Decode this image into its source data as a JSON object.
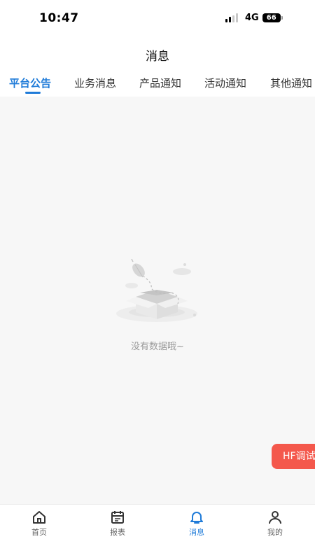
{
  "status_bar": {
    "time": "10:47",
    "network": "4G",
    "battery": "66"
  },
  "header": {
    "title": "消息"
  },
  "tabs": [
    {
      "label": "平台公告",
      "active": true
    },
    {
      "label": "业务消息",
      "active": false
    },
    {
      "label": "产品通知",
      "active": false
    },
    {
      "label": "活动通知",
      "active": false
    },
    {
      "label": "其他通知",
      "active": false
    }
  ],
  "empty_state": {
    "text": "没有数据哦~",
    "icon": "empty-box-icon"
  },
  "floating_button": {
    "label": "HF调试"
  },
  "bottom_nav": [
    {
      "label": "首页",
      "icon": "home-icon",
      "active": false
    },
    {
      "label": "报表",
      "icon": "calendar-icon",
      "active": false
    },
    {
      "label": "消息",
      "icon": "bell-icon",
      "active": true
    },
    {
      "label": "我的",
      "icon": "user-icon",
      "active": false
    }
  ],
  "colors": {
    "accent": "#1f7bd8",
    "float_button": "#f4584c",
    "content_bg": "#f7f7f7"
  }
}
